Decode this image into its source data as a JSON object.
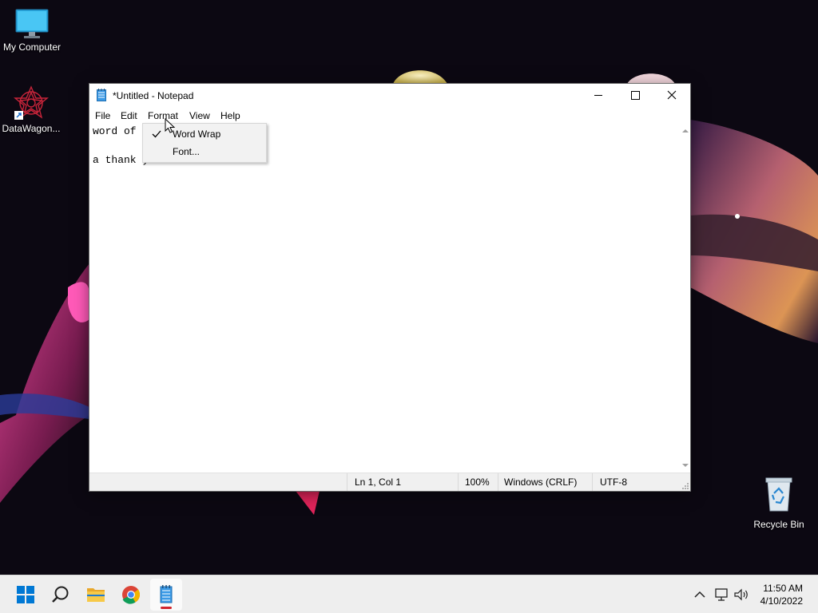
{
  "desktop": {
    "icons": [
      {
        "label": "My Computer",
        "icon": "computer-icon"
      },
      {
        "label": "DataWagon...",
        "icon": "datawagon-shortcut-icon"
      },
      {
        "label": "Recycle Bin",
        "icon": "recycle-bin-icon"
      }
    ]
  },
  "window": {
    "title": "*Untitled - Notepad",
    "app_icon": "notepad-icon",
    "controls": {
      "minimize": "minimize-icon",
      "maximize": "maximize-icon",
      "close": "close-icon"
    },
    "menu": [
      "File",
      "Edit",
      "Format",
      "View",
      "Help"
    ],
    "editor_lines": [
      "word of",
      "",
      "a thank you"
    ],
    "status": {
      "position": "Ln 1, Col 1",
      "zoom": "100%",
      "line_endings": "Windows (CRLF)",
      "encoding": "UTF-8"
    }
  },
  "format_menu": {
    "items": [
      {
        "label": "Word Wrap",
        "checked": true
      },
      {
        "label": "Font...",
        "checked": false
      }
    ]
  },
  "taskbar": {
    "apps": [
      "start-icon",
      "search-icon",
      "file-explorer-icon",
      "chrome-icon",
      "notepad-icon"
    ],
    "active_app": "notepad-icon",
    "tray_icons": [
      "chevron-up-icon",
      "network-icon",
      "volume-icon"
    ],
    "time": "11:50 AM",
    "date": "4/10/2022"
  },
  "colors": {
    "accent_blue": "#0078d4",
    "taskbar_bg": "#eeeeee",
    "active_indicator": "#d0252d"
  }
}
